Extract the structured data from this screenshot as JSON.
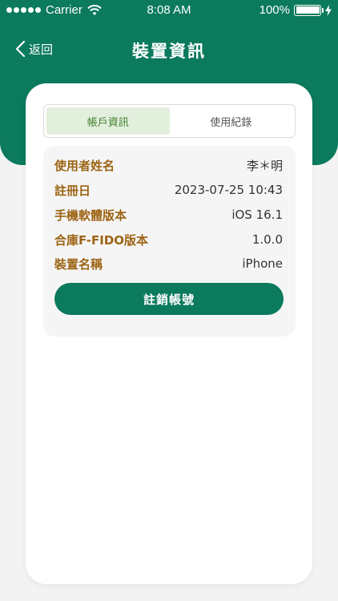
{
  "status_bar": {
    "carrier": "Carrier",
    "time": "8:08 AM",
    "battery": "100%"
  },
  "nav": {
    "back_label": "返回",
    "title": "裝置資訊"
  },
  "tabs": [
    {
      "label": "帳戶資訊",
      "active": true
    },
    {
      "label": "使用紀錄",
      "active": false
    }
  ],
  "info": [
    {
      "label": "使用者姓名",
      "value": "李＊明"
    },
    {
      "label": "註冊日",
      "value": "2023-07-25 10:43"
    },
    {
      "label": "手機軟體版本",
      "value": "iOS 16.1"
    },
    {
      "label": "合庫F-FIDO版本",
      "value": "1.0.0"
    },
    {
      "label": "裝置名稱",
      "value": "iPhone"
    }
  ],
  "logout_label": "註銷帳號",
  "colors": {
    "brand_green": "#0b7a5d",
    "label_brown": "#9c6414",
    "tab_active_bg": "#e3efdd"
  }
}
